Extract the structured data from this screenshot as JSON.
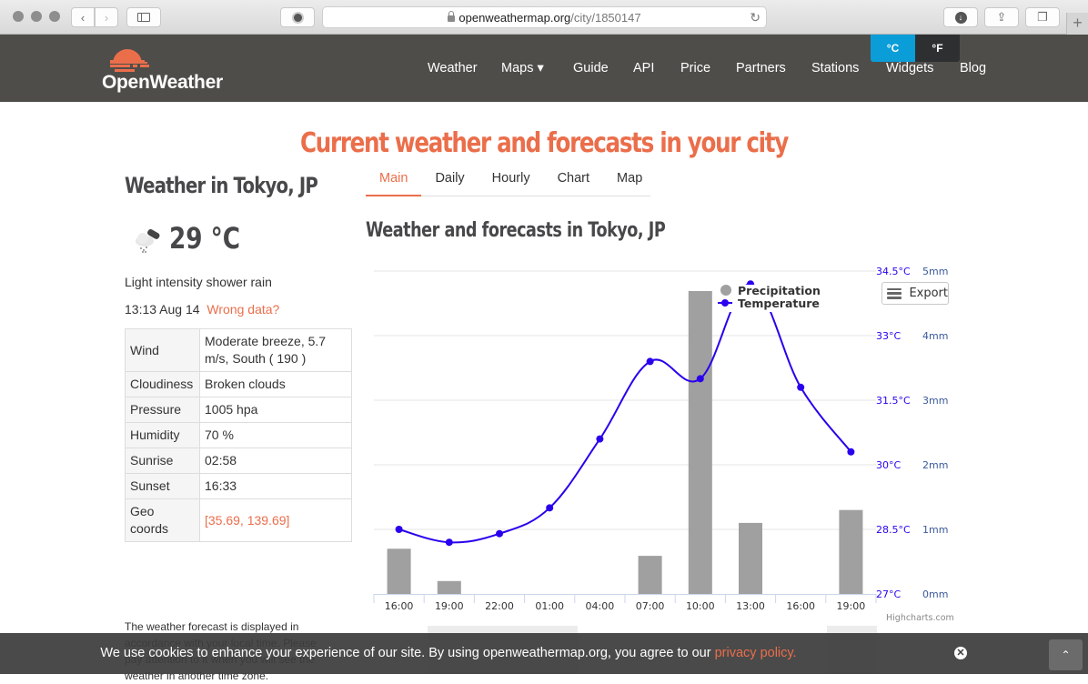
{
  "browser": {
    "url_host": "openweathermap.org",
    "url_path": "/city/1850147",
    "icons": [
      "back-icon",
      "forward-icon",
      "sidebar-icon",
      "privacy-icon",
      "lock-icon",
      "reload-icon",
      "download-icon",
      "share-icon",
      "tabs-icon",
      "new-tab-icon"
    ]
  },
  "header": {
    "logo_text": "OpenWeather",
    "nav": [
      {
        "label": "Weather"
      },
      {
        "label": "Maps ▾"
      },
      {
        "label": "Guide"
      },
      {
        "label": "API"
      },
      {
        "label": "Price"
      },
      {
        "label": "Partners"
      },
      {
        "label": "Stations"
      },
      {
        "label": "Widgets"
      },
      {
        "label": "Blog"
      }
    ],
    "units": {
      "celsius": "°C",
      "fahrenheit": "°F",
      "selected": "celsius"
    }
  },
  "page": {
    "title": "Current weather and forecasts in your city"
  },
  "current": {
    "city_title": "Weather in Tokyo, JP",
    "temperature": "29 °C",
    "icon": "shower-rain-icon",
    "description": "Light intensity shower rain",
    "datetime": "13:13 Aug 14",
    "wrong_data_link": "Wrong data?",
    "details": [
      {
        "label": "Wind",
        "value": "Moderate breeze, 5.7 m/s, South ( 190 )"
      },
      {
        "label": "Cloudiness",
        "value": "Broken clouds"
      },
      {
        "label": "Pressure",
        "value": "1005 hpa"
      },
      {
        "label": "Humidity",
        "value": "70 %"
      },
      {
        "label": "Sunrise",
        "value": "02:58"
      },
      {
        "label": "Sunset",
        "value": "16:33"
      },
      {
        "label": "Geo coords",
        "value": "[35.69, 139.69]"
      }
    ],
    "forecast_note": "The weather forecast is displayed in accordance with your local time. Please pay attention to it when you will see the weather in another time zone."
  },
  "tabs": [
    {
      "label": "Main",
      "active": true
    },
    {
      "label": "Daily",
      "active": false
    },
    {
      "label": "Hourly",
      "active": false
    },
    {
      "label": "Chart",
      "active": false
    },
    {
      "label": "Map",
      "active": false
    }
  ],
  "section_title": "Weather and forecasts in Tokyo, JP",
  "chart_export_label": "Export",
  "chart_credits": "Highcharts.com",
  "chart_data": {
    "type": "bar",
    "title": "",
    "categories": [
      "16:00",
      "19:00",
      "22:00",
      "01:00",
      "04:00",
      "07:00",
      "10:00",
      "13:00",
      "16:00",
      "19:00"
    ],
    "series": [
      {
        "name": "Precipitation",
        "type": "bar",
        "axis": "right",
        "unit": "mm",
        "color": "#a0a0a0",
        "values": [
          0.7,
          0.2,
          0,
          0,
          0,
          0.59,
          4.69,
          1.1,
          0,
          1.3
        ]
      },
      {
        "name": "Temperature",
        "type": "line",
        "axis": "left",
        "unit": "°C",
        "color": "#2a00ee",
        "values": [
          28.5,
          28.2,
          28.4,
          29.0,
          30.6,
          32.4,
          32.0,
          34.2,
          31.8,
          30.3
        ]
      }
    ],
    "temp_axis": {
      "min": 27,
      "max": 34.5,
      "ticks": [
        "27°C",
        "28.5°C",
        "30°C",
        "31.5°C",
        "33°C",
        "34.5°C"
      ]
    },
    "precip_axis": {
      "min": 0,
      "max": 5,
      "ticks": [
        "0mm",
        "1mm",
        "2mm",
        "3mm",
        "4mm",
        "5mm"
      ]
    },
    "legend": {
      "position": "top-right",
      "items": [
        "Precipitation",
        "Temperature"
      ]
    },
    "grid": true
  },
  "cookie": {
    "text": "We use cookies to enhance your experience of our site. By using openweathermap.org, you agree to our ",
    "link": "privacy policy."
  }
}
